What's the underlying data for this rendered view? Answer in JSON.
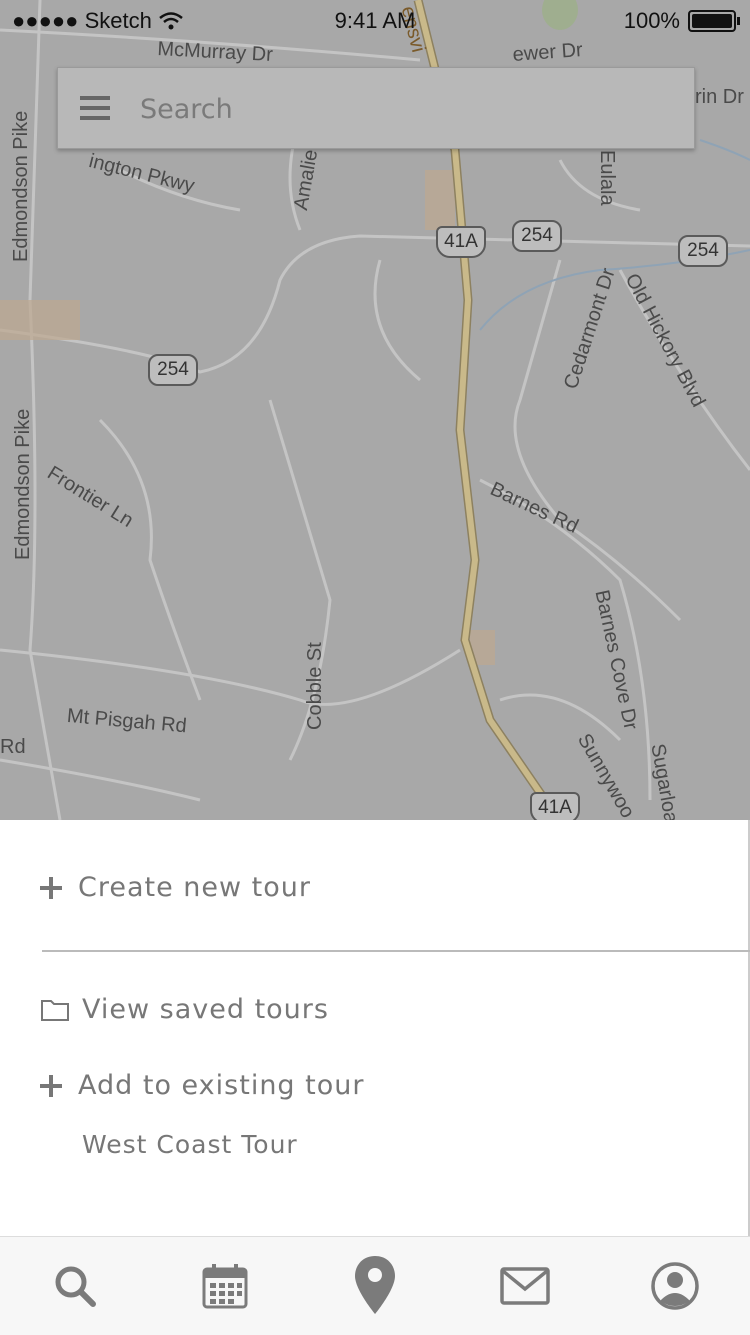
{
  "status_bar": {
    "signal": "●●●●●",
    "carrier": "Sketch",
    "time": "9:41 AM",
    "battery_percent": "100%"
  },
  "search": {
    "placeholder": "Search",
    "menu_icon": "hamburger-menu-icon"
  },
  "map": {
    "labels": [
      "McMurray Dr",
      "Edmondson Pike",
      "Edmondson Pike",
      "Frontier Ln",
      "Mt Pisgah Rd",
      "Cobble St",
      "Barnes Rd",
      "Barnes Cove Dr",
      "Cedarmont Dr",
      "Old Hickory Blvd",
      "Eulala",
      "Sunnywoo",
      "Sugarloa",
      "Amalie",
      "ington Pkwy",
      "ewer Dr",
      "rin Dr",
      "Rd",
      "ensvi"
    ],
    "shields": [
      "41A",
      "254",
      "254",
      "254",
      "41A"
    ]
  },
  "sheet": {
    "create_label": "Create new tour",
    "view_saved_label": "View saved tours",
    "add_existing_label": "Add to existing tour",
    "existing_tours": [
      "West Coast Tour"
    ]
  },
  "tabs": [
    {
      "icon": "search-icon"
    },
    {
      "icon": "calendar-icon"
    },
    {
      "icon": "map-pin-icon"
    },
    {
      "icon": "mail-icon"
    },
    {
      "icon": "profile-icon"
    }
  ],
  "colors": {
    "map_background": "#a8a8a8",
    "highway": "#c9b98a",
    "sheet_text": "#777777",
    "icon_gray": "#7b7b7b"
  }
}
